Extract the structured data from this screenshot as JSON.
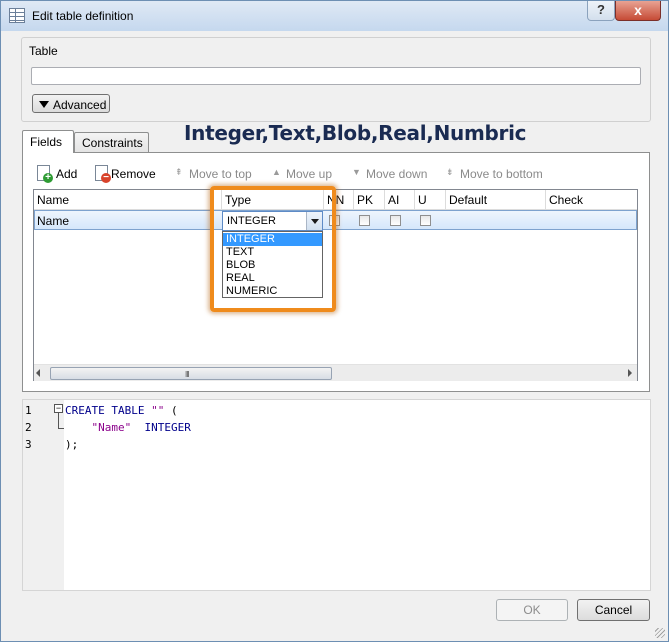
{
  "window": {
    "title": "Edit table definition",
    "help_glyph": "?",
    "close_glyph": "x"
  },
  "table_group": {
    "label": "Table",
    "name_value": "",
    "advanced_label": "Advanced"
  },
  "annotation": "Integer,Text,Blob,Real,Numbric",
  "tabs": [
    {
      "label": "Fields",
      "active": true
    },
    {
      "label": "Constraints",
      "active": false
    }
  ],
  "toolbar": {
    "add": "Add",
    "remove": "Remove",
    "move_to_top": "Move to top",
    "move_up": "Move up",
    "move_down": "Move down",
    "move_to_bottom": "Move to bottom"
  },
  "grid": {
    "columns": [
      "Name",
      "Type",
      "NN",
      "PK",
      "AI",
      "U",
      "Default",
      "Check"
    ],
    "rows": [
      {
        "name": "Name",
        "type": "INTEGER",
        "nn": false,
        "pk": false,
        "ai": false,
        "u": false,
        "default": "",
        "check": ""
      }
    ],
    "scroll_grip": "III"
  },
  "type_dropdown": {
    "selected": "INTEGER",
    "options": [
      "INTEGER",
      "TEXT",
      "BLOB",
      "REAL",
      "NUMERIC"
    ]
  },
  "sql": {
    "line_numbers": [
      "1",
      "2",
      "3"
    ],
    "fold_glyph": "−",
    "line1_kw": "CREATE TABLE",
    "line1_str": "\"\"",
    "line1_paren": "(",
    "line2_str": "\"Name\"",
    "line2_type": "INTEGER",
    "line3": ");"
  },
  "buttons": {
    "ok": "OK",
    "cancel": "Cancel"
  },
  "colors": {
    "highlight": "#ef8b1c",
    "selection": "#3399ff",
    "keyword": "#00008b",
    "string": "#8b008b"
  }
}
